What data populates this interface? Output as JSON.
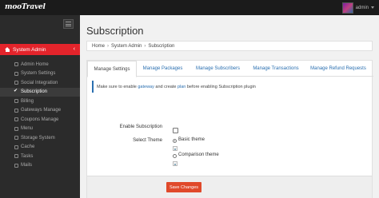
{
  "app": {
    "logo": "mooTravel"
  },
  "topbar": {
    "username": "admin",
    "avatar_icon": "user-avatar"
  },
  "sidebar": {
    "header_label": "System Admin",
    "items": [
      {
        "label": "Admin Home",
        "icon": "home-icon"
      },
      {
        "label": "System Settings",
        "icon": "gear-icon"
      },
      {
        "label": "Social Integration",
        "icon": "share-icon"
      },
      {
        "label": "Subscription",
        "icon": "check-icon",
        "active": true
      },
      {
        "label": "Billing",
        "icon": "card-icon"
      },
      {
        "label": "Gateways Manage",
        "icon": "gear-icon"
      },
      {
        "label": "Coupons Manage",
        "icon": "tag-icon"
      },
      {
        "label": "Menu",
        "icon": "menu-icon"
      },
      {
        "label": "Storage System",
        "icon": "cloud-icon"
      },
      {
        "label": "Cache",
        "icon": "database-icon"
      },
      {
        "label": "Tasks",
        "icon": "task-icon"
      },
      {
        "label": "Mails",
        "icon": "mail-icon"
      }
    ]
  },
  "page": {
    "title": "Subscription"
  },
  "breadcrumb": {
    "items": [
      "Home",
      "System Admin",
      "Subscription"
    ]
  },
  "tabs": [
    "Manage Settings",
    "Manage Packages",
    "Manage Subscribers",
    "Manage Transactions",
    "Manage Refund Requests"
  ],
  "notice": {
    "prefix": "Make sure to enable",
    "link1": "gateway",
    "middle": "and create",
    "link2": "plan",
    "suffix": "before enabling Subscription plugin"
  },
  "form": {
    "enable_label": "Enable Subscription",
    "theme_label": "Select Theme",
    "theme_options": [
      "Basic theme",
      "Comparison theme"
    ],
    "selected_theme": "Basic theme"
  },
  "actions": {
    "save_label": "Save Changes"
  },
  "colors": {
    "accent": "#e3242b",
    "button": "#e0492a",
    "link": "#2a6fb0",
    "sidebar": "#2b2b2b",
    "topbar": "#1b1b1b"
  }
}
